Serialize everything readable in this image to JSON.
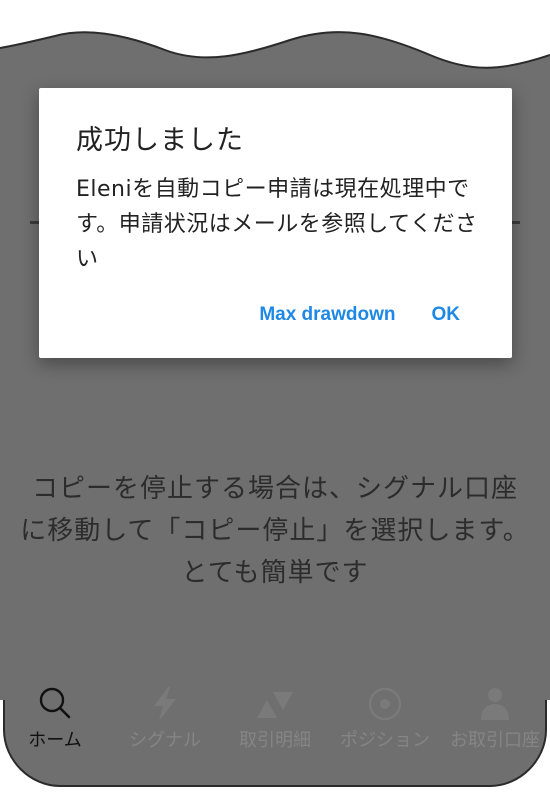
{
  "dialog": {
    "title": "成功しました",
    "message": "Eleniを自動コピー申請は現在処理中です。申請状況はメールを参照してください",
    "buttons": {
      "secondary": "Max drawdown",
      "primary": "OK"
    }
  },
  "background_message": "コピーを停止する場合は、シグナル口座に移動して「コピー停止」を選択します。とても簡単です",
  "bottom_nav": {
    "items": [
      {
        "label": "ホーム",
        "icon": "search-icon",
        "active": true
      },
      {
        "label": "シグナル",
        "icon": "lightning-icon",
        "active": false
      },
      {
        "label": "取引明細",
        "icon": "triangles-icon",
        "active": false
      },
      {
        "label": "ポジション",
        "icon": "target-circle-icon",
        "active": false
      },
      {
        "label": "お取引口座",
        "icon": "person-icon",
        "active": false
      }
    ]
  },
  "colors": {
    "accent": "#1e88e5",
    "overlay": "#6f6f6f"
  }
}
